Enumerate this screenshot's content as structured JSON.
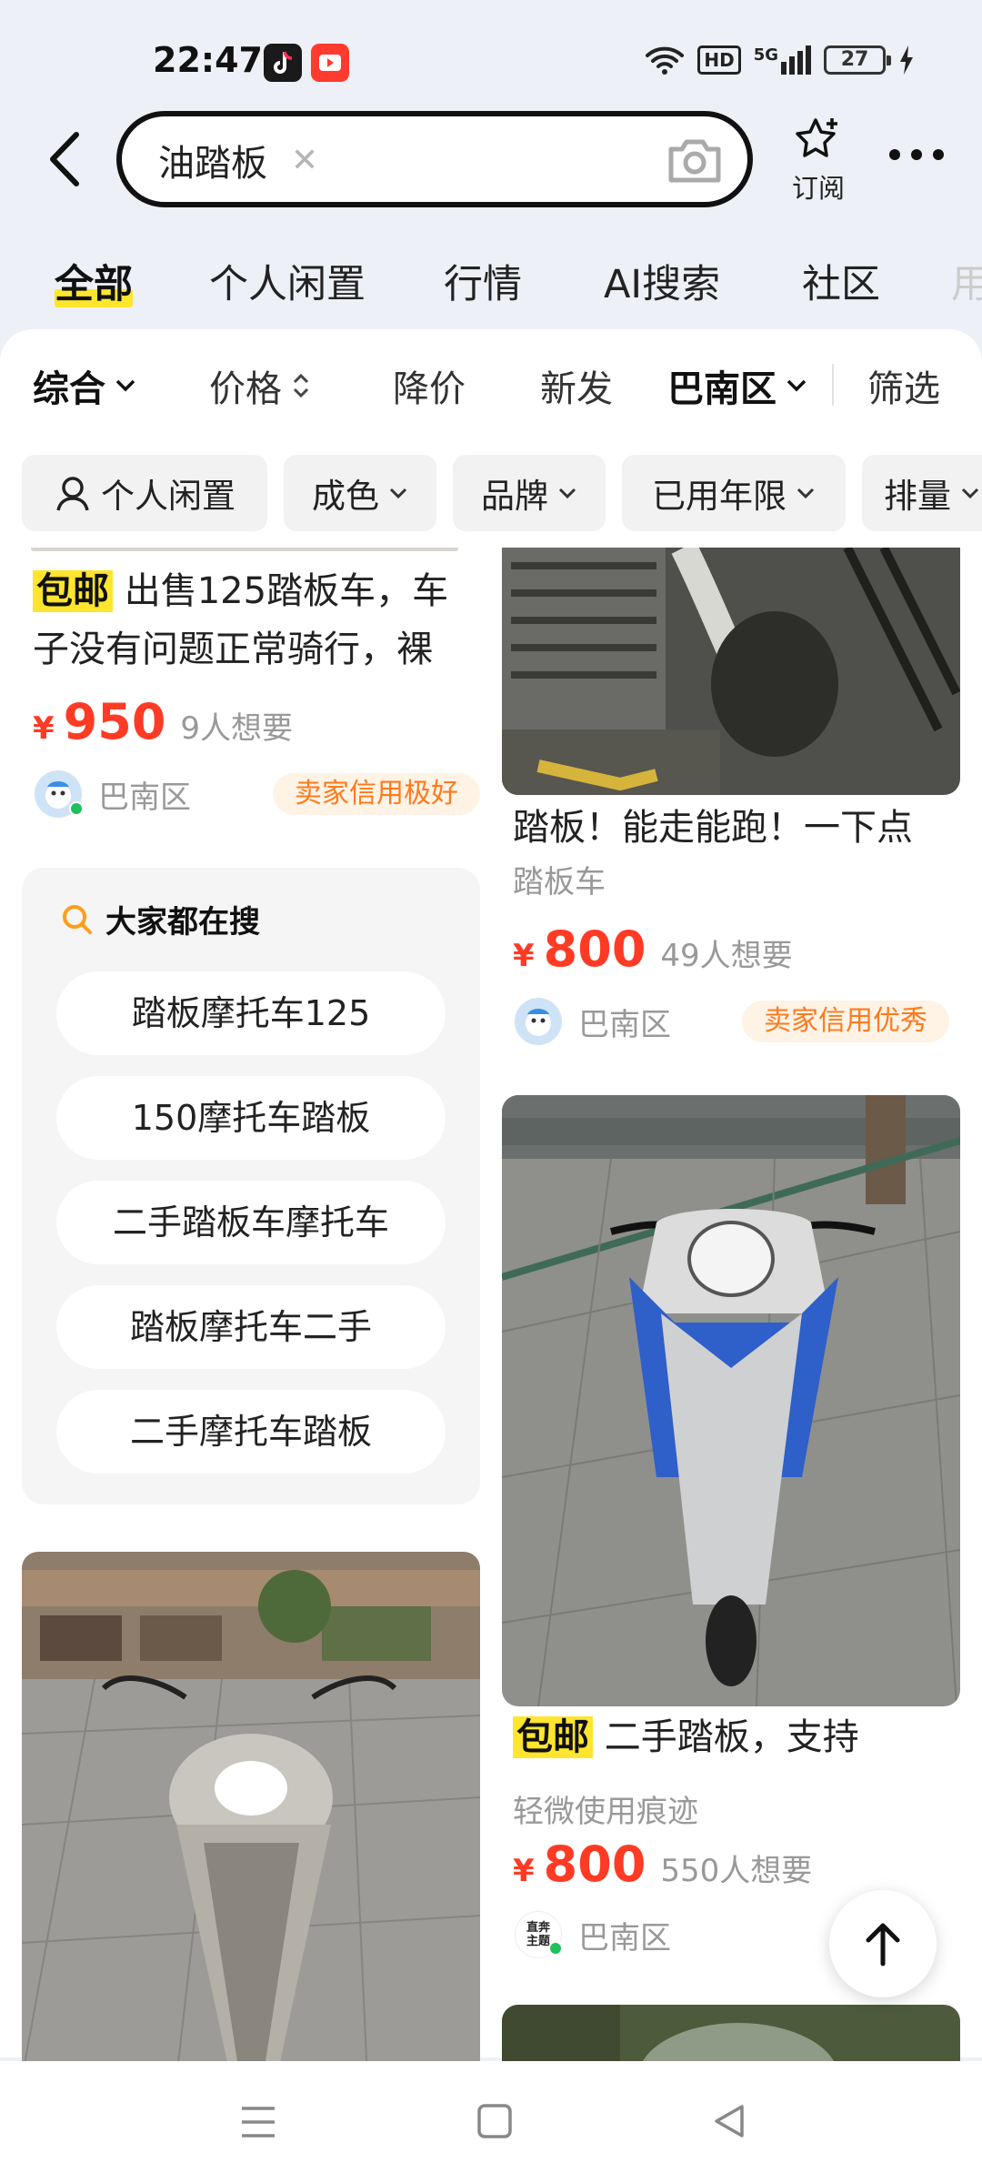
{
  "status_bar": {
    "time": "22:47",
    "network": "5G",
    "hd": "HD",
    "battery": "27",
    "icons": [
      "tiktok-icon",
      "video-app-icon",
      "wifi-icon",
      "signal-icon",
      "charging-icon"
    ]
  },
  "search": {
    "query": "油踏板",
    "subscribe_label": "订阅"
  },
  "category_tabs": [
    {
      "label": "全部",
      "active": true
    },
    {
      "label": "个人闲置"
    },
    {
      "label": "行情"
    },
    {
      "label": "AI搜索"
    },
    {
      "label": "社区"
    },
    {
      "label": "用"
    }
  ],
  "sort_bar": {
    "comprehensive": "综合",
    "price": "价格",
    "price_drop": "降价",
    "newest": "新发",
    "region": "巴南区",
    "filter": "筛选"
  },
  "filter_chips": {
    "personal": "个人闲置",
    "condition": "成色",
    "brand": "品牌",
    "years_used": "已用年限",
    "displacement": "排量"
  },
  "listings": [
    {
      "tag": "包邮",
      "title": "出售125踏板车，车子没有问题正常骑行，裸",
      "currency": "¥",
      "price": "950",
      "wants": "9人想要",
      "location": "巴南区",
      "credit": "卖家信用极好"
    },
    {
      "title": "踏板！能走能跑！一下点",
      "subtitle": "踏板车",
      "currency": "¥",
      "price": "800",
      "wants": "49人想要",
      "location": "巴南区",
      "credit": "卖家信用优秀"
    },
    {
      "tag": "包邮",
      "title": "二手踏板，支持",
      "subtitle": "轻微使用痕迹",
      "currency": "¥",
      "price": "800",
      "wants": "550人想要",
      "location": "巴南区",
      "avatar_text": "直奔主题"
    }
  ],
  "hot_search": {
    "title": "大家都在搜",
    "items": [
      "踏板摩托车125",
      "150摩托车踏板",
      "二手踏板车摩托车",
      "踏板摩托车二手",
      "二手摩托车踏板"
    ]
  },
  "colors": {
    "accent_yellow": "#ffe52d",
    "price_red": "#ff3b25",
    "credit_orange": "#ff7a1c"
  }
}
